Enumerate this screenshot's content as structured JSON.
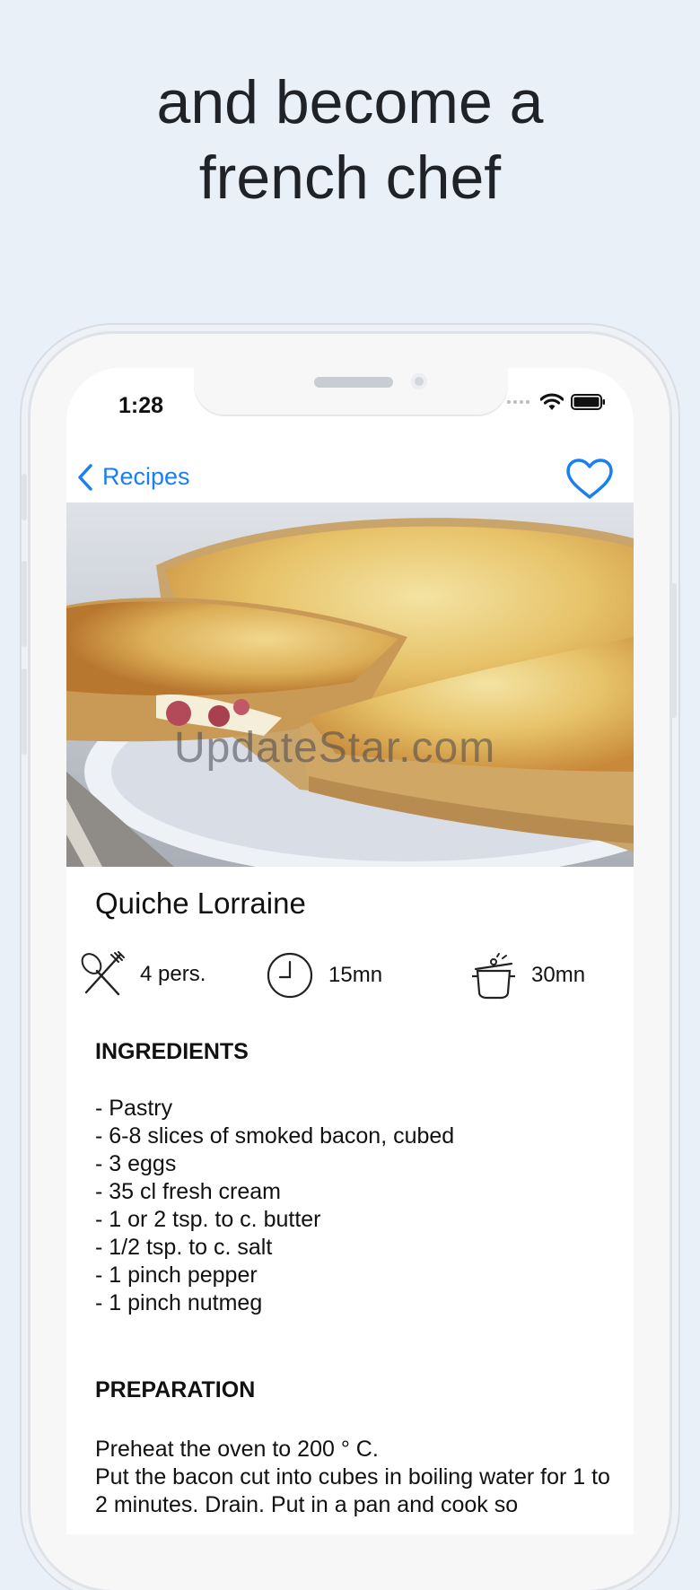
{
  "headline": {
    "line1": "and become a",
    "line2": "french chef"
  },
  "status": {
    "time": "1:28"
  },
  "nav": {
    "back_label": "Recipes"
  },
  "hero": {
    "watermark": "UpdateStar.com"
  },
  "recipe": {
    "title": "Quiche Lorraine",
    "servings": "4 pers.",
    "prep_time": "15mn",
    "cook_time": "30mn",
    "ingredients_heading": "INGREDIENTS",
    "ingredients": [
      "- Pastry",
      "- 6-8 slices of smoked bacon, cubed",
      "- 3 eggs",
      "- 35 cl fresh cream",
      "- 1 or 2 tsp. to c. butter",
      "- 1/2 tsp. to c. salt",
      "- 1 pinch pepper",
      "- 1 pinch nutmeg"
    ],
    "preparation_heading": "PREPARATION",
    "preparation": [
      "Preheat the oven to 200 ° C.",
      "Put the bacon cut into cubes in boiling water for 1 to 2 minutes. Drain. Put in a pan and cook so"
    ]
  },
  "colors": {
    "accent": "#1a7ff0",
    "background": "#eaf0f8"
  }
}
